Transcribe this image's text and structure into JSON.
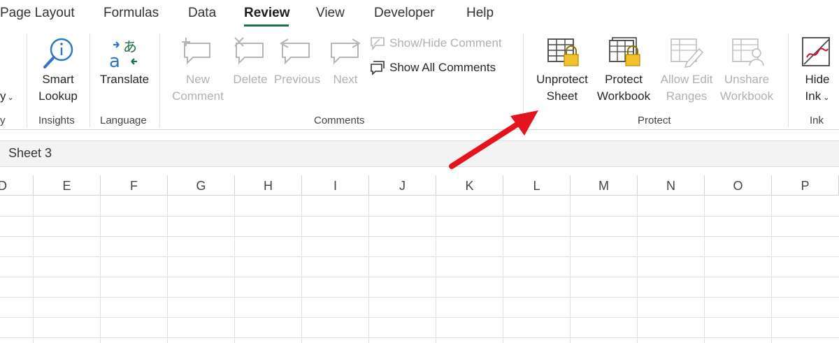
{
  "tabs": [
    "Page Layout",
    "Formulas",
    "Data",
    "Review",
    "View",
    "Developer",
    "Help"
  ],
  "active_tab": "Review",
  "ribbon": {
    "left_partial": {
      "label": "y",
      "group": "y"
    },
    "insights": {
      "button": [
        "Smart",
        "Lookup"
      ],
      "group": "Insights"
    },
    "language": {
      "button": [
        "Translate"
      ],
      "group": "Language"
    },
    "comments": {
      "new": [
        "New",
        "Comment"
      ],
      "delete": [
        "Delete"
      ],
      "previous": [
        "Previous"
      ],
      "next": [
        "Next"
      ],
      "show_hide": "Show/Hide Comment",
      "show_all": "Show All Comments",
      "group": "Comments"
    },
    "protect": {
      "unprotect_sheet": [
        "Unprotect",
        "Sheet"
      ],
      "protect_workbook": [
        "Protect",
        "Workbook"
      ],
      "allow_edit": [
        "Allow Edit",
        "Ranges"
      ],
      "unshare": [
        "Unshare",
        "Workbook"
      ],
      "group": "Protect"
    },
    "ink": {
      "button": [
        "Hide",
        "Ink"
      ],
      "group": "Ink"
    }
  },
  "sheet_name": "Sheet 3",
  "columns": [
    "D",
    "E",
    "F",
    "G",
    "H",
    "I",
    "J",
    "K",
    "L",
    "M",
    "N",
    "O",
    "P"
  ],
  "colors": {
    "accent": "#1e7145",
    "arrow": "#e3141b",
    "disabled": "#b0b0b0"
  }
}
